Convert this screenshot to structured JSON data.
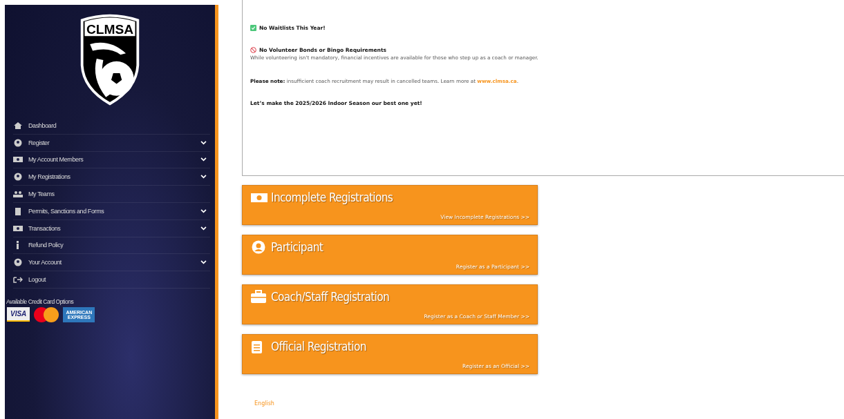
{
  "sidebar": {
    "logo_text": "CLMSA",
    "items": [
      {
        "label": "Dashboard",
        "expandable": false
      },
      {
        "label": "Register",
        "expandable": true
      },
      {
        "label": "My Account Members",
        "expandable": true
      },
      {
        "label": "My Registrations",
        "expandable": true
      },
      {
        "label": "My Teams",
        "expandable": false
      },
      {
        "label": "Permits, Sanctions and Forms",
        "expandable": true
      },
      {
        "label": "Transactions",
        "expandable": true
      },
      {
        "label": "Refund Policy",
        "expandable": false
      },
      {
        "label": "Your Account",
        "expandable": true
      },
      {
        "label": "Logout",
        "expandable": false
      }
    ],
    "credit_cards_label": "Available Credit Card Options",
    "cards": [
      {
        "kind": "visa",
        "text": "VISA"
      },
      {
        "kind": "mastercard"
      },
      {
        "kind": "amex",
        "text": "AMERICAN EXPRESS"
      }
    ]
  },
  "notice": {
    "paragraphs": [
      {
        "kind": "check",
        "heading": "No Waitlists This Year!"
      },
      {
        "kind": "no",
        "heading": "No Volunteer Bonds or Bingo Requirements",
        "text": "While volunteering isn't mandatory, financial incentives are available for those who step up as a coach or manager."
      },
      {
        "kind": "note",
        "text": "**Please note:** insufficient coach recruitment may result in cancelled teams. Learn more at",
        "link": "www.clmsa.ca",
        "after": "."
      },
      {
        "kind": "plain",
        "heading": "Let’s make the 2025/2026 Indoor Season our best one yet!"
      }
    ]
  },
  "tiles": [
    {
      "title": "Incomplete Registrations",
      "link": "View Incomplete Registrations >>"
    },
    {
      "title": "Participant",
      "link": "Register as a Participant >>"
    },
    {
      "title": "Coach/Staff Registration",
      "link": "Register as a Coach or Staff Member >>"
    },
    {
      "title": "Official Registration",
      "link": "Register as an Official >>"
    }
  ],
  "footer": {
    "language": "English"
  }
}
